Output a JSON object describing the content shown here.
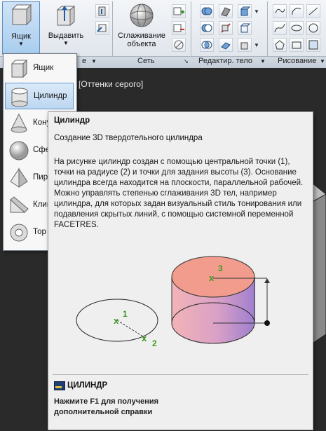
{
  "ribbon": {
    "box_button": "Ящик",
    "extrude_button": "Выдавить",
    "smooth_button_line1": "Сглаживание",
    "smooth_button_line2": "объекта",
    "panel_mesh": "Сеть",
    "panel_solid_edit": "Редактир. тело",
    "panel_draw": "Рисование",
    "panel_primitive_tail": "е"
  },
  "viewport": {
    "label": "[Оттенки серого]"
  },
  "dropdown": {
    "items": [
      {
        "label": "Ящик",
        "icon": "box-icon"
      },
      {
        "label": "Цилиндр",
        "icon": "cylinder-icon"
      },
      {
        "label": "Конус",
        "icon": "cone-icon"
      },
      {
        "label": "Сфера",
        "icon": "sphere-icon"
      },
      {
        "label": "Пирамида",
        "icon": "pyramid-icon"
      },
      {
        "label": "Клин",
        "icon": "wedge-icon"
      },
      {
        "label": "Тор",
        "icon": "torus-icon"
      }
    ],
    "selected": "Цилиндр"
  },
  "tooltip": {
    "title": "Цилиндр",
    "subtitle": "Создание 3D твердотельного цилиндра",
    "body": "На рисунке цилиндр создан с помощью центральной точки (1), точки на радиусе (2) и точки для задания высоты (3). Основание цилиндра всегда находится на плоскости, параллельной рабочей. Можно управлять степенью сглаживания 3D тел, например цилиндра, для которых задан визуальный стиль тонирования или подавления скрытых линий, с помощью системной переменной FACETRES.",
    "figure_labels": [
      "1",
      "2",
      "3"
    ],
    "command": "ЦИЛИНДР",
    "help_text": "Нажмите F1 для получения дополнительной справки"
  },
  "colors": {
    "accent_green": "#3d9b1f",
    "cylinder_top": "#f19c8c"
  }
}
